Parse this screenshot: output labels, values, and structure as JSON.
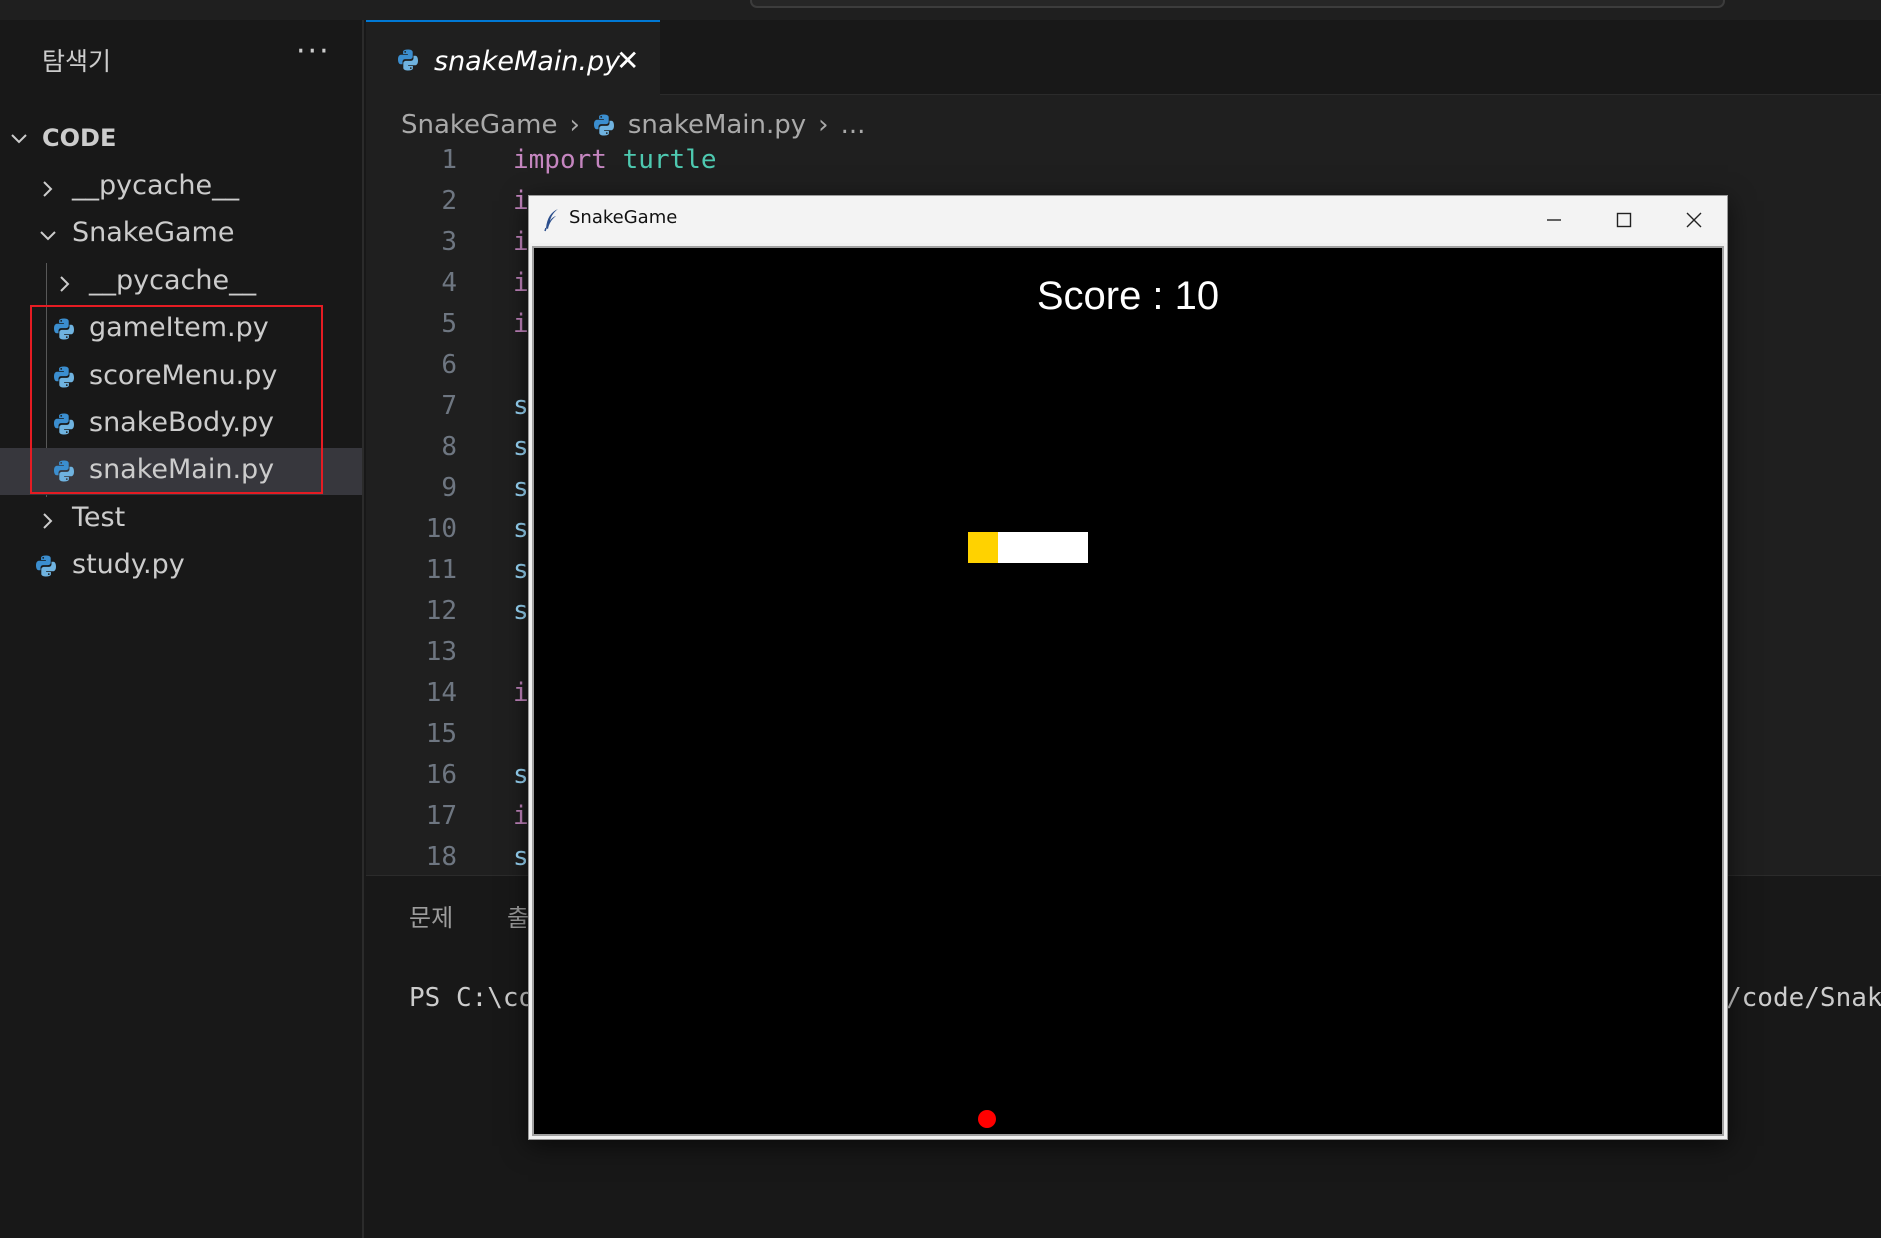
{
  "sidebar": {
    "title": "탐색기",
    "more": "···",
    "root": "CODE",
    "items": [
      {
        "label": "__pycache__",
        "kind": "folder",
        "expanded": false
      },
      {
        "label": "SnakeGame",
        "kind": "folder",
        "expanded": true
      },
      {
        "label": "__pycache__",
        "kind": "folder",
        "expanded": false
      },
      {
        "label": "gameItem.py",
        "kind": "python-file"
      },
      {
        "label": "scoreMenu.py",
        "kind": "python-file"
      },
      {
        "label": "snakeBody.py",
        "kind": "python-file"
      },
      {
        "label": "snakeMain.py",
        "kind": "python-file",
        "selected": true
      },
      {
        "label": "Test",
        "kind": "folder",
        "expanded": false
      },
      {
        "label": "study.py",
        "kind": "python-file"
      }
    ]
  },
  "editor": {
    "tab_label": "snakeMain.py",
    "tab_close": "✕",
    "breadcrumb": {
      "folder": "SnakeGame",
      "file": "snakeMain.py",
      "more": "..."
    },
    "lines": [
      {
        "n": "1",
        "a": "import",
        "b": " turtle"
      },
      {
        "n": "2",
        "a": "i",
        "b": ""
      },
      {
        "n": "3",
        "a": "i",
        "b": ""
      },
      {
        "n": "4",
        "a": "i",
        "b": ""
      },
      {
        "n": "5",
        "a": "i",
        "b": ""
      },
      {
        "n": "6",
        "a": "",
        "b": ""
      },
      {
        "n": "7",
        "a": "s",
        "b": ""
      },
      {
        "n": "8",
        "a": "s",
        "b": ""
      },
      {
        "n": "9",
        "a": "s",
        "b": ""
      },
      {
        "n": "10",
        "a": "s",
        "b": ""
      },
      {
        "n": "11",
        "a": "s",
        "b": ""
      },
      {
        "n": "12",
        "a": "s",
        "b": ""
      },
      {
        "n": "13",
        "a": "",
        "b": ""
      },
      {
        "n": "14",
        "a": "i",
        "b": ""
      },
      {
        "n": "15",
        "a": "",
        "b": ""
      },
      {
        "n": "16",
        "a": "s",
        "b": ""
      },
      {
        "n": "17",
        "a": "i",
        "b": ""
      },
      {
        "n": "18",
        "a": "s",
        "b": ""
      }
    ]
  },
  "panel": {
    "tab_problems": "문제",
    "tab_output_partial": "출",
    "terminal_left": "PS C:\\co",
    "terminal_right": "/code/Snak"
  },
  "game_window": {
    "title": "SnakeGame",
    "score_text": "Score : 10",
    "snake": [
      "yellow",
      "white",
      "white",
      "white"
    ],
    "colors": {
      "head": "#ffd200",
      "body": "#ffffff",
      "food": "#ff0000",
      "background": "#000000"
    }
  }
}
